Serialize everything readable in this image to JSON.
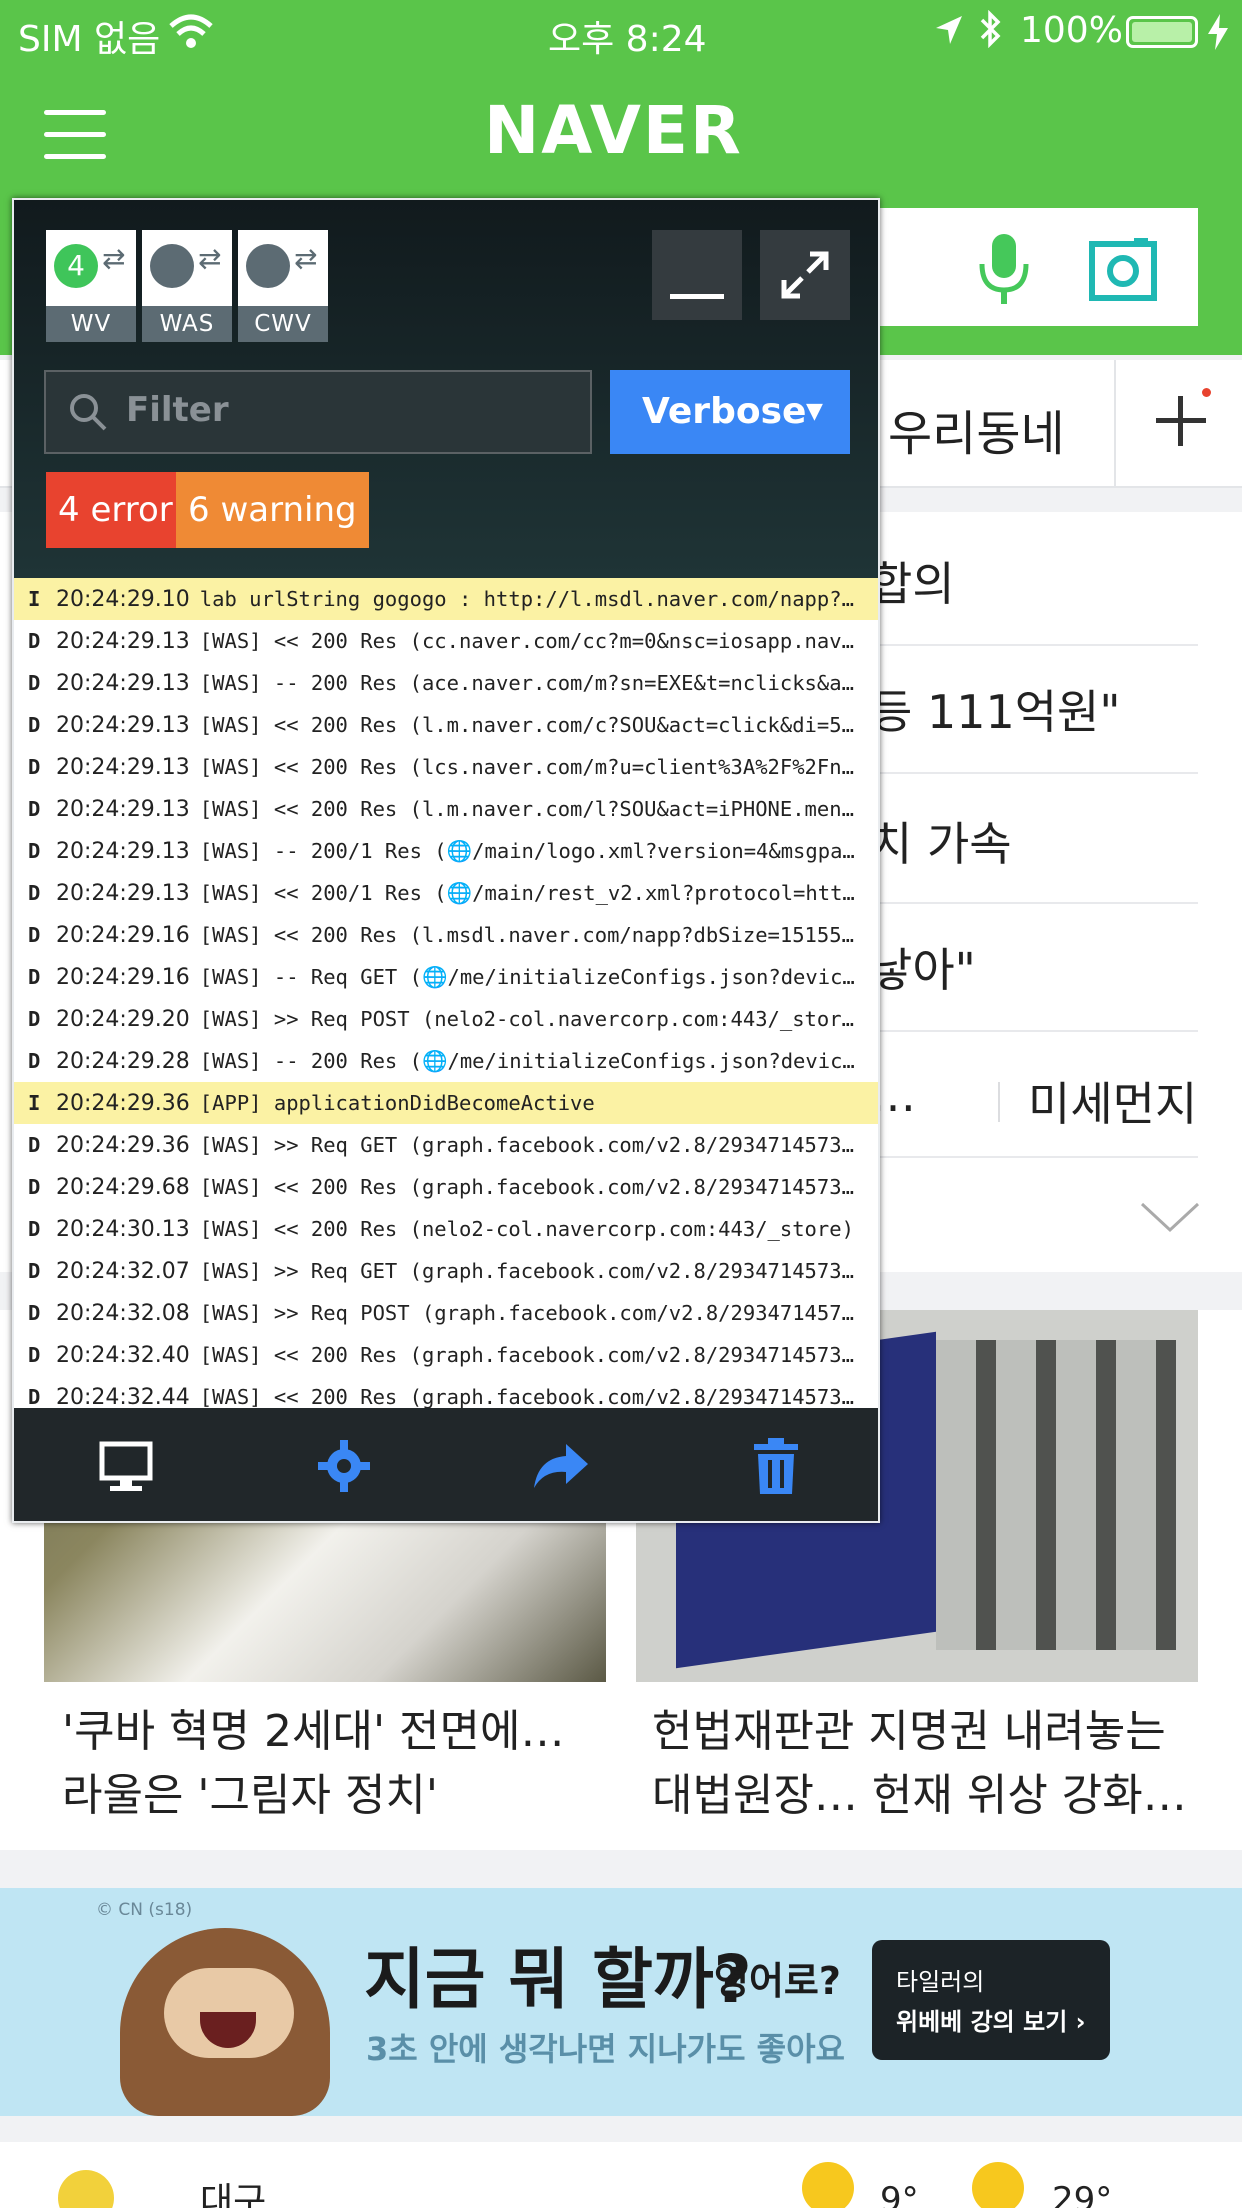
{
  "status_bar": {
    "carrier": "SIM 없음",
    "time": "오후 8:24",
    "battery": "100%"
  },
  "header": {
    "logo": "NAVER"
  },
  "page": {
    "tabs_visible": [
      "우리동네"
    ],
    "news": [
      "합의",
      "등 111억원\"",
      "치 가속",
      "낳아\"",
      "…",
      "미세먼지"
    ],
    "cards": [
      {
        "title": "'쿠바 혁명 2세대' 전면에… 라울은 '그림자 정치'"
      },
      {
        "title": "헌법재판관 지명권 내려놓는 대법원장… 헌재 위상 강화…"
      }
    ],
    "banner": {
      "copyright": "© CN (s18)",
      "headline": "지금 뭐 할까?",
      "headline_suffix": "영어로?",
      "sub": "3초 안에 생각나면 지나가도 좋아요",
      "cta_line1": "타일러의",
      "cta_line2": "위베베 강의 보기 ›"
    },
    "weather": {
      "city": "대구",
      "temp1": "9°",
      "temp2": "29°"
    }
  },
  "console": {
    "tags": [
      {
        "label": "WV",
        "count": "4",
        "color": "#3fc55a"
      },
      {
        "label": "WAS",
        "count": "",
        "color": "#5c6b73"
      },
      {
        "label": "CWV",
        "count": "",
        "color": "#5c6b73"
      }
    ],
    "filter_placeholder": "Filter",
    "level": "Verbose",
    "badges": {
      "error": "4 error",
      "warning": "6 warning",
      "error_color": "#e8432f",
      "warning_color": "#ef8a35"
    },
    "logs": [
      {
        "lvl": "I",
        "ts": "20:24:29.10",
        "msg": "lab urlString gogogo : http://l.msdl.naver.com/napp?…",
        "info": true
      },
      {
        "lvl": "D",
        "ts": "20:24:29.13",
        "msg": "[WAS] << 200 Res (cc.naver.com/cc?m=0&nsc=iosapp.nav…",
        "info": false
      },
      {
        "lvl": "D",
        "ts": "20:24:29.13",
        "msg": "[WAS] -- 200 Res (ace.naver.com/m?sn=EXE&t=nclicks&a…",
        "info": false
      },
      {
        "lvl": "D",
        "ts": "20:24:29.13",
        "msg": "[WAS] << 200 Res (l.m.naver.com/c?SOU&act=click&di=5…",
        "info": false
      },
      {
        "lvl": "D",
        "ts": "20:24:29.13",
        "msg": "[WAS] << 200 Res (lcs.naver.com/m?u=client%3A%2F%2Fn…",
        "info": false
      },
      {
        "lvl": "D",
        "ts": "20:24:29.13",
        "msg": "[WAS] << 200 Res (l.m.naver.com/l?SOU&act=iPHONE.men…",
        "info": false
      },
      {
        "lvl": "D",
        "ts": "20:24:29.13",
        "msg": "[WAS] -- 200/1 Res (🌐/main/logo.xml?version=4&msgpa…",
        "info": false
      },
      {
        "lvl": "D",
        "ts": "20:24:29.13",
        "msg": "[WAS] << 200/1 Res (🌐/main/rest_v2.xml?protocol=htt…",
        "info": false
      },
      {
        "lvl": "D",
        "ts": "20:24:29.16",
        "msg": "[WAS] << 200 Res (l.msdl.naver.com/napp?dbSize=15155…",
        "info": false
      },
      {
        "lvl": "D",
        "ts": "20:24:29.16",
        "msg": "[WAS] -- Req GET (🌐/me/initializeConfigs.json?devic…",
        "info": false
      },
      {
        "lvl": "D",
        "ts": "20:24:29.20",
        "msg": "[WAS] >> Req POST (nelo2-col.navercorp.com:443/_stor…",
        "info": false
      },
      {
        "lvl": "D",
        "ts": "20:24:29.28",
        "msg": "[WAS] -- 200 Res (🌐/me/initializeConfigs.json?devic…",
        "info": false
      },
      {
        "lvl": "I",
        "ts": "20:24:29.36",
        "msg": "[APP] applicationDidBecomeActive",
        "info": true
      },
      {
        "lvl": "D",
        "ts": "20:24:29.36",
        "msg": "[WAS] >> Req GET (graph.facebook.com/v2.8/2934714573…",
        "info": false
      },
      {
        "lvl": "D",
        "ts": "20:24:29.68",
        "msg": "[WAS] << 200 Res (graph.facebook.com/v2.8/2934714573…",
        "info": false
      },
      {
        "lvl": "D",
        "ts": "20:24:30.13",
        "msg": "[WAS] << 200 Res (nelo2-col.navercorp.com:443/_store)",
        "info": false
      },
      {
        "lvl": "D",
        "ts": "20:24:32.07",
        "msg": "[WAS] >> Req GET (graph.facebook.com/v2.8/2934714573…",
        "info": false
      },
      {
        "lvl": "D",
        "ts": "20:24:32.08",
        "msg": "[WAS] >> Req POST (graph.facebook.com/v2.8/293471457…",
        "info": false
      },
      {
        "lvl": "D",
        "ts": "20:24:32.40",
        "msg": "[WAS] << 200 Res (graph.facebook.com/v2.8/2934714573…",
        "info": false
      },
      {
        "lvl": "D",
        "ts": "20:24:32.44",
        "msg": "[WAS] << 200 Res (graph.facebook.com/v2.8/2934714573…",
        "info": false
      }
    ]
  }
}
